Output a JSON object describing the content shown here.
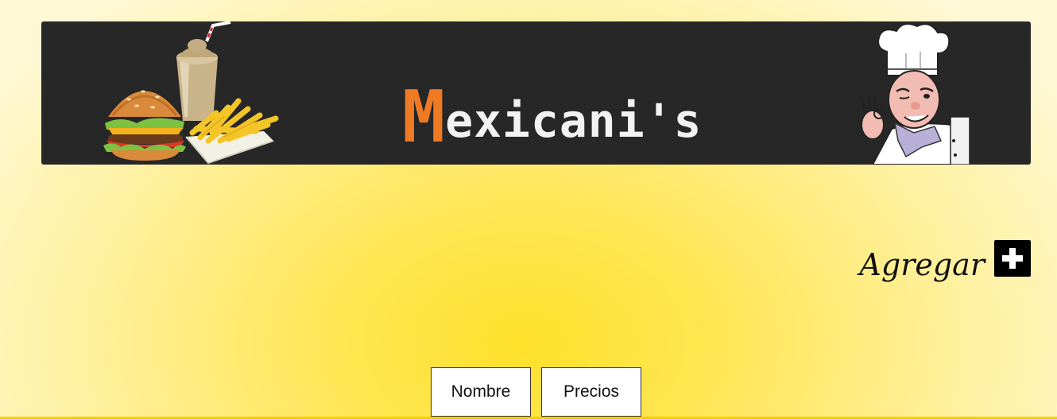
{
  "header": {
    "logo_initial": "M",
    "logo_rest": "exicani's",
    "logo_initial_color": "#ef7a24",
    "background_color": "#272727",
    "left_illustration": "burger-fries-shake-illustration",
    "right_illustration": "chef-illustration"
  },
  "actions": {
    "add_label": "Agregar",
    "add_icon": "plus-square-icon"
  },
  "sort_buttons": [
    {
      "label": "Nombre"
    },
    {
      "label": "Precios"
    }
  ]
}
